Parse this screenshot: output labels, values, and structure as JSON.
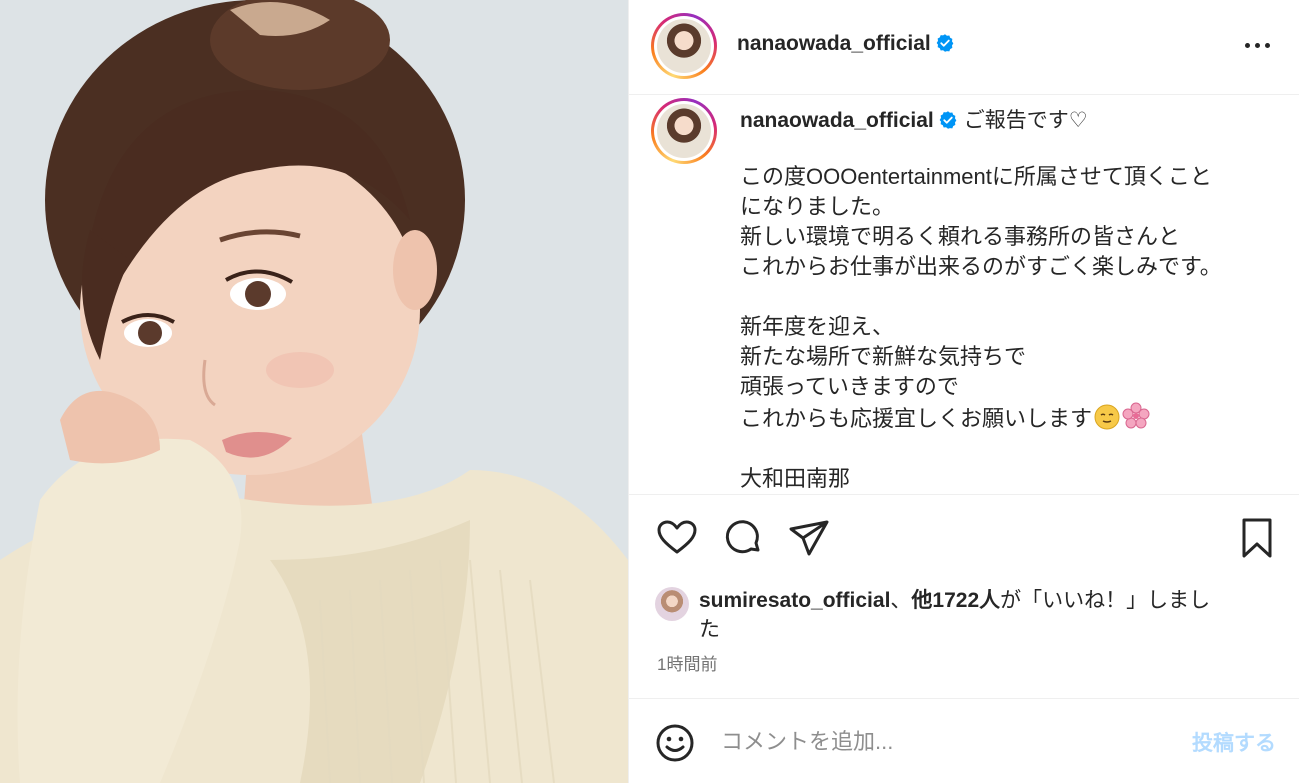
{
  "post": {
    "username": "nanaowada_official",
    "verified_icon": "verified-badge-icon",
    "more_icon": "more-options-icon"
  },
  "caption": {
    "username": "nanaowada_official",
    "lead": "ご報告です♡",
    "lines": [
      "",
      "この度OOOentertainmentに所属させて頂くこと",
      "になりました。",
      "新しい環境で明るく頼れる事務所の皆さんと",
      "これからお仕事が出来るのがすごく楽しみです。",
      "",
      "新年度を迎え、",
      "新たな場所で新鮮な気持ちで",
      "頑張っていきますので",
      "これからも応援宜しくお願いします",
      "",
      "大和田南那"
    ],
    "emojis": [
      "relieved-face-emoji",
      "cherry-blossom-emoji"
    ]
  },
  "actions": {
    "icons": [
      "heart-icon",
      "comment-icon",
      "share-icon",
      "bookmark-icon"
    ]
  },
  "likes": {
    "user": "sumiresato_official",
    "separator": "、",
    "others": "他1722人",
    "suffix_line1": "が「いいね！」しまし",
    "suffix_line2": "た"
  },
  "timestamp": "1時間前",
  "comment": {
    "placeholder": "コメントを追加...",
    "post_label": "投稿する",
    "emoji_icon": "smiley-face-icon"
  },
  "colors": {
    "accent_blue": "#0095f6",
    "post_disabled": "#b3dbff",
    "verified": "#0095f6",
    "text": "#262626",
    "muted": "#737373"
  }
}
